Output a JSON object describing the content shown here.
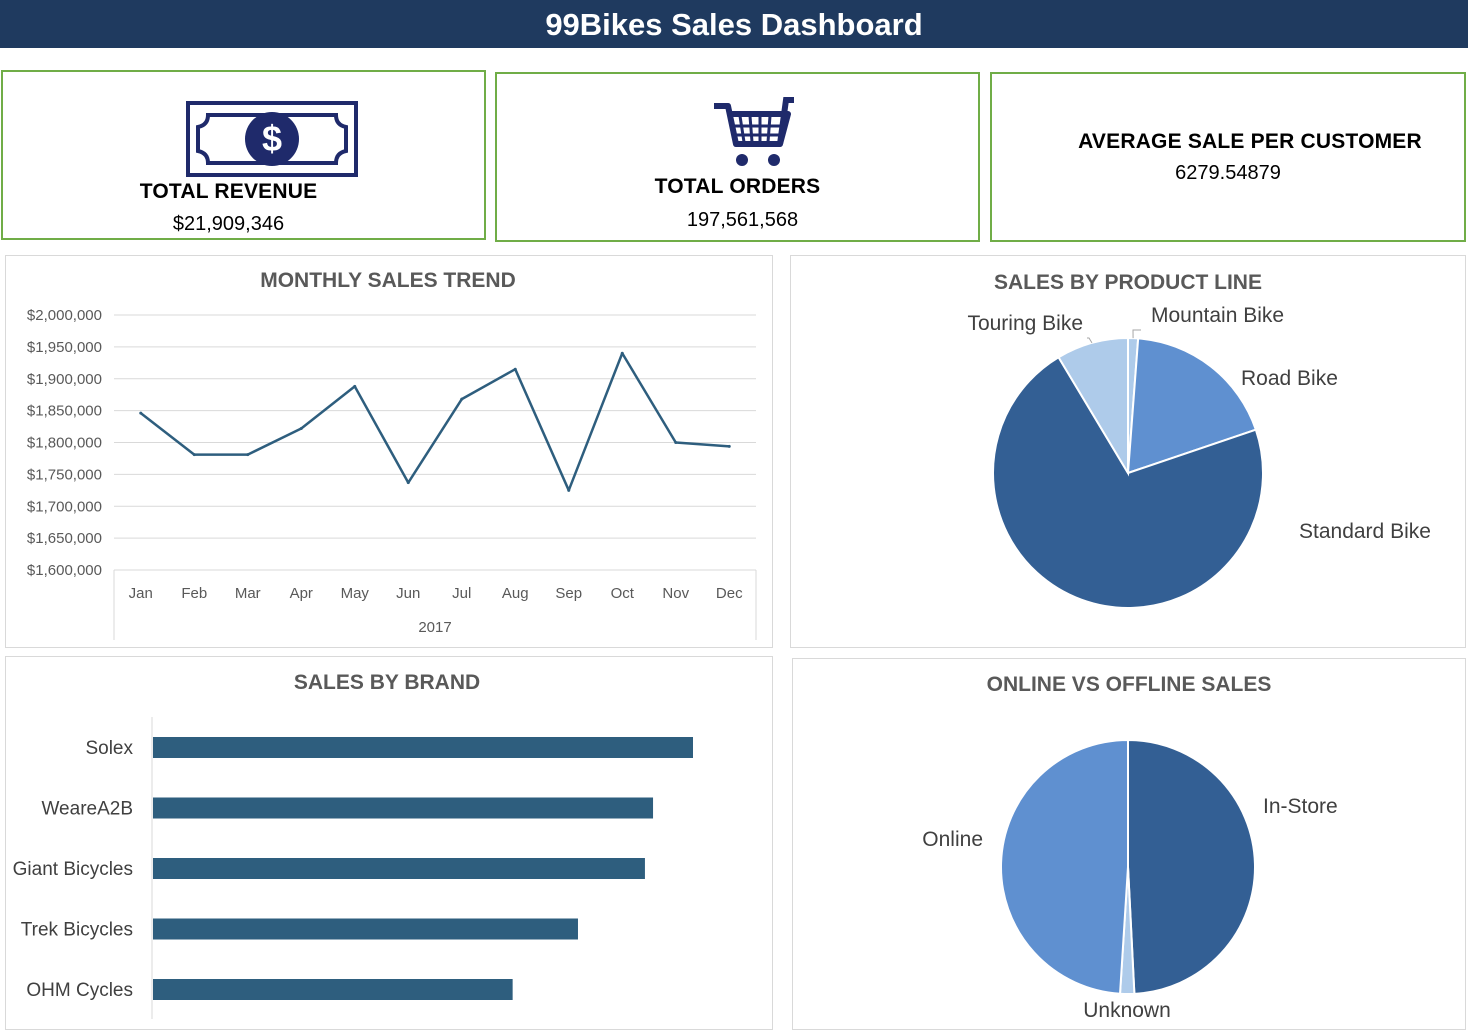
{
  "header": {
    "title": "99Bikes Sales Dashboard"
  },
  "kpis": {
    "revenue": {
      "label": "TOTAL REVENUE",
      "value": "$21,909,346",
      "icon": "dollar-bill-icon"
    },
    "orders": {
      "label": "TOTAL ORDERS",
      "value": "197,561,568",
      "icon": "shopping-cart-icon"
    },
    "average": {
      "label": "AVERAGE SALE PER CUSTOMER",
      "value": "6279.54879"
    }
  },
  "colors": {
    "header": "#1f3a5f",
    "kpi_border": "#70ad47",
    "line": "#2e5e7e",
    "bar": "#2e5e7e",
    "icon": "#1f2a6b"
  },
  "chart_data": [
    {
      "type": "line",
      "title": "MONTHLY SALES TREND",
      "categories": [
        "Jan",
        "Feb",
        "Mar",
        "Apr",
        "May",
        "Jun",
        "Jul",
        "Aug",
        "Sep",
        "Oct",
        "Nov",
        "Dec"
      ],
      "group_label": "2017",
      "values": [
        1846000,
        1781000,
        1781000,
        1822000,
        1888000,
        1737000,
        1868000,
        1915000,
        1725000,
        1940000,
        1800000,
        1794000
      ],
      "ylim": [
        1600000,
        2000000
      ],
      "y_ticks": [
        "$2,000,000",
        "$1,950,000",
        "$1,900,000",
        "$1,850,000",
        "$1,800,000",
        "$1,750,000",
        "$1,700,000",
        "$1,650,000",
        "$1,600,000"
      ],
      "grid": true
    },
    {
      "type": "pie",
      "title": "SALES BY PRODUCT LINE",
      "labels": [
        "Mountain Bike",
        "Road Bike",
        "Standard Bike",
        "Touring Bike"
      ],
      "values": [
        1.2,
        18.6,
        71.6,
        8.6
      ],
      "colors": [
        "#aecbea",
        "#5f90d0",
        "#335f94",
        "#aecbea"
      ]
    },
    {
      "type": "bar",
      "title": "SALES BY BRAND",
      "orientation": "horizontal",
      "categories": [
        "Solex",
        "WeareA2B",
        "Giant Bicycles",
        "Trek Bicycles",
        "OHM Cycles"
      ],
      "values": [
        100,
        92.6,
        91.1,
        78.7,
        66.6
      ]
    },
    {
      "type": "pie",
      "title": "ONLINE VS OFFLINE SALES",
      "labels": [
        "In-Store",
        "Unknown",
        "Online"
      ],
      "values": [
        49.2,
        1.8,
        49.0
      ],
      "colors": [
        "#335f94",
        "#aecbea",
        "#5f90d0"
      ]
    }
  ]
}
